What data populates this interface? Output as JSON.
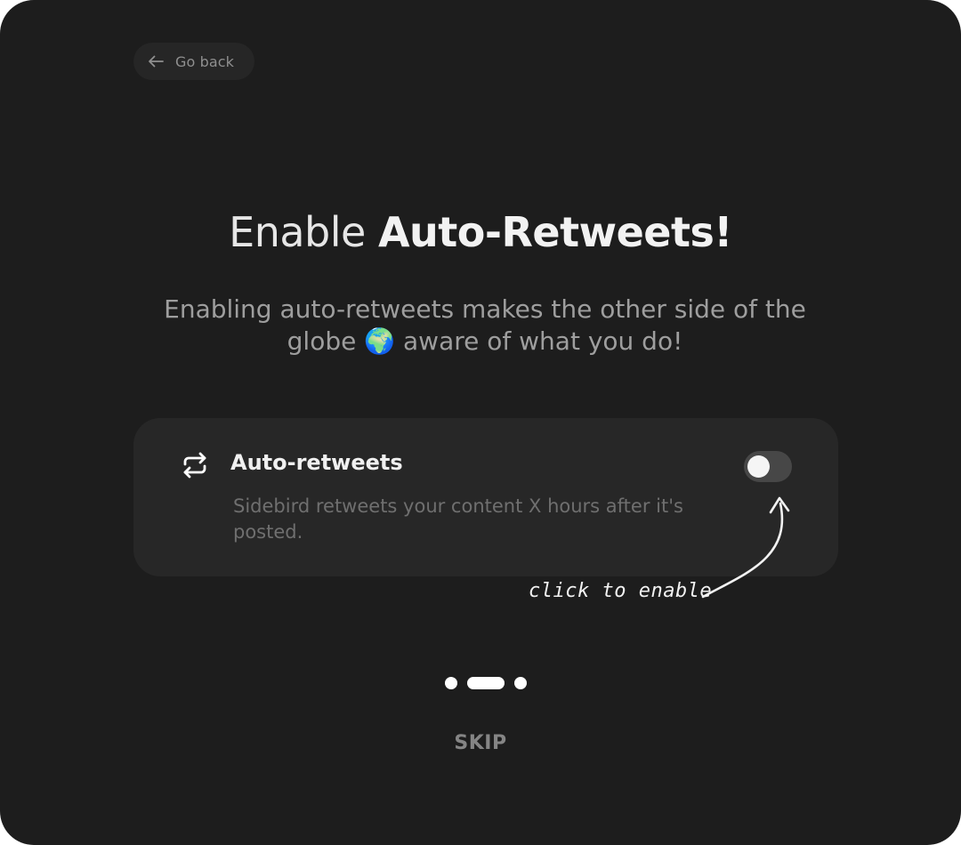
{
  "back_button": {
    "label": "Go back",
    "icon": "arrow-left-icon"
  },
  "heading": {
    "prefix": "Enable ",
    "bold": "Auto-Retweets!"
  },
  "subtitle": {
    "before": "Enabling auto-retweets makes the other side of the globe ",
    "emoji": "🌍",
    "after": " aware of what you do!"
  },
  "card": {
    "icon": "repeat-icon",
    "title": "Auto-retweets",
    "description": "Sidebird retweets your content X hours after it's posted.",
    "toggle_enabled": false
  },
  "annotation": {
    "text": "click to enable"
  },
  "pagination": {
    "total": 3,
    "current": 2
  },
  "skip_label": "SKIP",
  "colors": {
    "background": "#1d1d1d",
    "card": "#272727",
    "toggle_off": "#474747"
  }
}
